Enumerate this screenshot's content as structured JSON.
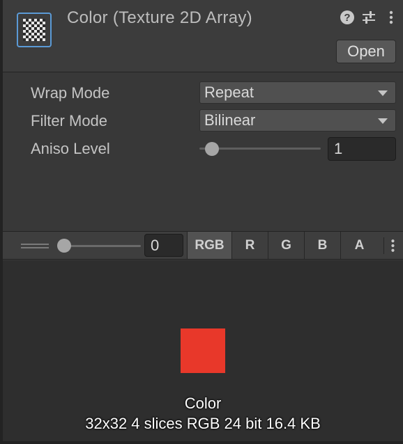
{
  "header": {
    "title": "Color (Texture 2D Array)",
    "open_label": "Open",
    "asset_icon": "texture-checker-icon",
    "icons": [
      "help-icon",
      "preset-sliders-icon",
      "kebab-menu-icon"
    ]
  },
  "properties": {
    "wrap_mode": {
      "label": "Wrap Mode",
      "value": "Repeat"
    },
    "filter_mode": {
      "label": "Filter Mode",
      "value": "Bilinear"
    },
    "aniso_level": {
      "label": "Aniso Level",
      "value": "1"
    }
  },
  "preview_toolbar": {
    "mip_value": "0",
    "channels": [
      {
        "label": "RGB",
        "active": true
      },
      {
        "label": "R",
        "active": false
      },
      {
        "label": "G",
        "active": false
      },
      {
        "label": "B",
        "active": false
      },
      {
        "label": "A",
        "active": false
      }
    ]
  },
  "preview": {
    "swatch_color": "#e8382a",
    "name": "Color",
    "info": "32x32 4 slices RGB 24 bit 16.4 KB"
  },
  "colors": {
    "accent_border": "#5b9ad6",
    "panel": "#383838",
    "preview_bg": "#2e2e2e"
  }
}
